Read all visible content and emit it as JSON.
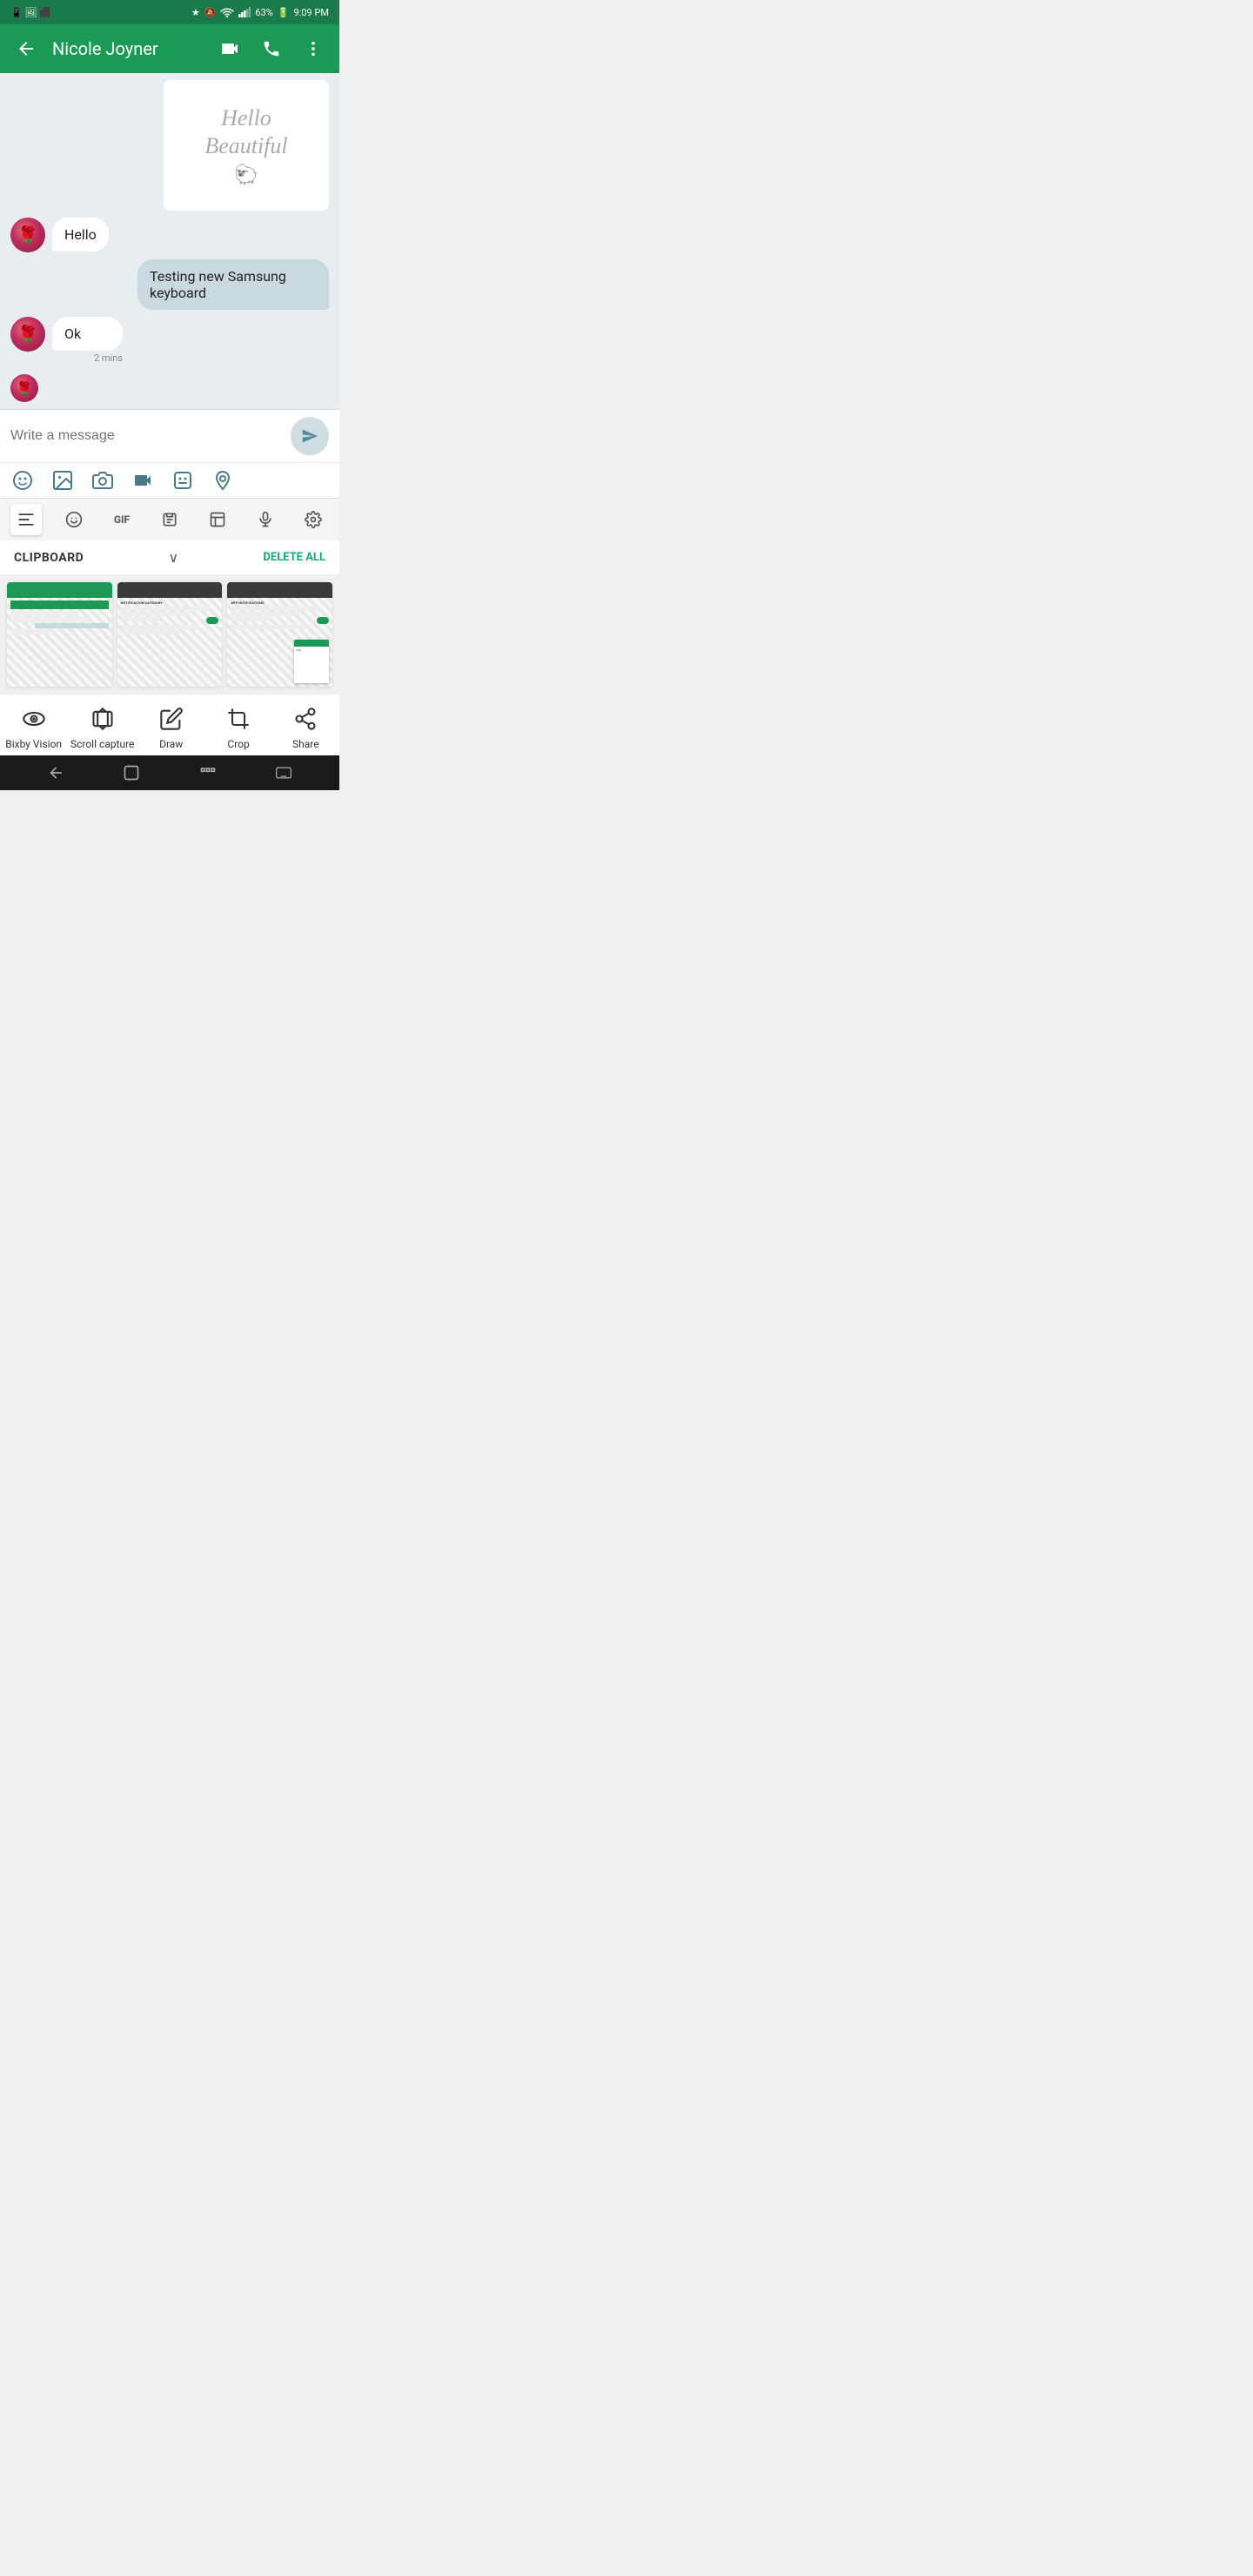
{
  "statusBar": {
    "time": "9:09 PM",
    "battery": "63%",
    "signal": "signal",
    "wifi": "wifi",
    "bluetooth": "BT",
    "mute": "mute"
  },
  "appBar": {
    "title": "Nicole Joyner",
    "back": "back",
    "video_call": "video-call",
    "phone_call": "phone-call",
    "more": "more-options"
  },
  "messages": [
    {
      "type": "image",
      "direction": "sent",
      "content": "Hello\nBeautiful"
    },
    {
      "type": "text",
      "direction": "received",
      "text": "Hello",
      "hasAvatar": true
    },
    {
      "type": "text",
      "direction": "sent",
      "text": "Testing new Samsung keyboard"
    },
    {
      "type": "text",
      "direction": "received",
      "text": "Ok",
      "hasAvatar": true,
      "timestamp": "2 mins"
    },
    {
      "type": "avatar_only",
      "direction": "received",
      "hasAvatar": true
    }
  ],
  "input": {
    "placeholder": "Write a message"
  },
  "inputIcons": [
    {
      "name": "emoji",
      "label": "emoji"
    },
    {
      "name": "gallery",
      "label": "gallery"
    },
    {
      "name": "camera",
      "label": "camera"
    },
    {
      "name": "video",
      "label": "video"
    },
    {
      "name": "sticker",
      "label": "sticker"
    },
    {
      "name": "location",
      "label": "location"
    }
  ],
  "keyboardTabs": [
    {
      "name": "text",
      "active": true
    },
    {
      "name": "emoji",
      "active": false
    },
    {
      "name": "gif",
      "active": false
    },
    {
      "name": "clipboard",
      "active": false
    },
    {
      "name": "keyboard-layout",
      "active": false
    },
    {
      "name": "mic",
      "active": false
    },
    {
      "name": "settings",
      "active": false
    }
  ],
  "clipboard": {
    "title": "CLIPBOARD",
    "deleteAll": "DELETE ALL"
  },
  "bottomActions": [
    {
      "name": "bixby-vision",
      "label": "Bixby Vision",
      "icon": "eye"
    },
    {
      "name": "scroll-capture",
      "label": "Scroll capture",
      "icon": "scroll"
    },
    {
      "name": "draw",
      "label": "Draw",
      "icon": "pencil"
    },
    {
      "name": "crop",
      "label": "Crop",
      "icon": "crop"
    },
    {
      "name": "share",
      "label": "Share",
      "icon": "share"
    }
  ],
  "navBar": {
    "back": "back",
    "home": "home",
    "recents": "recents",
    "keyboard": "keyboard"
  }
}
